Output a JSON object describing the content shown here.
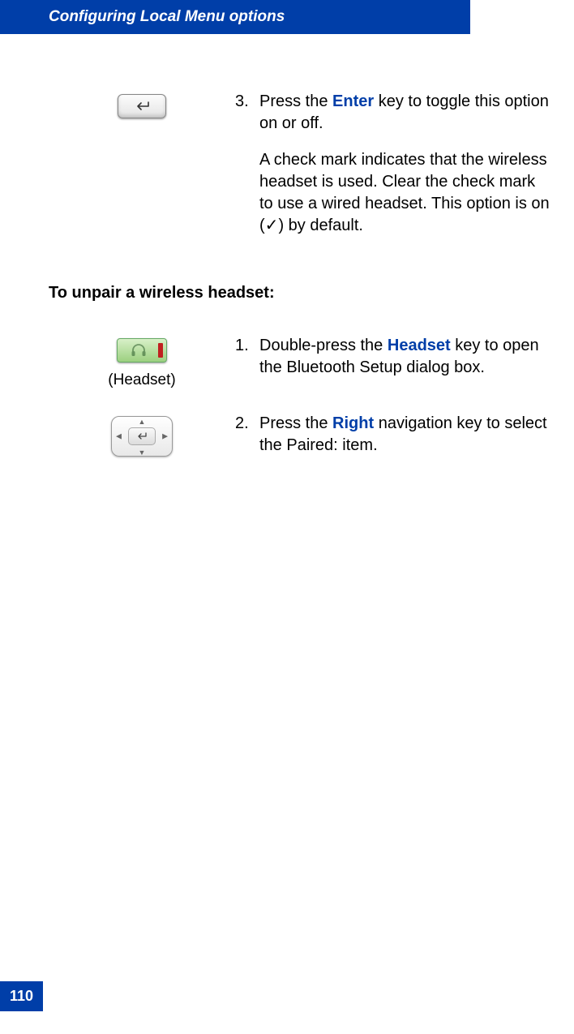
{
  "header": {
    "title": "Configuring Local Menu options"
  },
  "page_number": "110",
  "section1": {
    "step3": {
      "num": "3.",
      "line_a": "Press the ",
      "kw": "Enter",
      "line_b": " key to toggle this option on or off.",
      "para2_a": "A check mark indicates that the wireless headset is used. Clear the check mark to use a wired headset. This option is on (",
      "para2_check": "✓",
      "para2_b": ") by default."
    }
  },
  "subheading": "To unpair a wireless headset:",
  "section2": {
    "headset_caption": "(Headset)",
    "step1": {
      "num": "1.",
      "a": "Double-press the ",
      "kw": "Headset",
      "b": " key to open the Bluetooth Setup dialog box."
    },
    "step2": {
      "num": "2.",
      "a": "Press the ",
      "kw": "Right",
      "b": " navigation key to select the Paired: item."
    }
  }
}
